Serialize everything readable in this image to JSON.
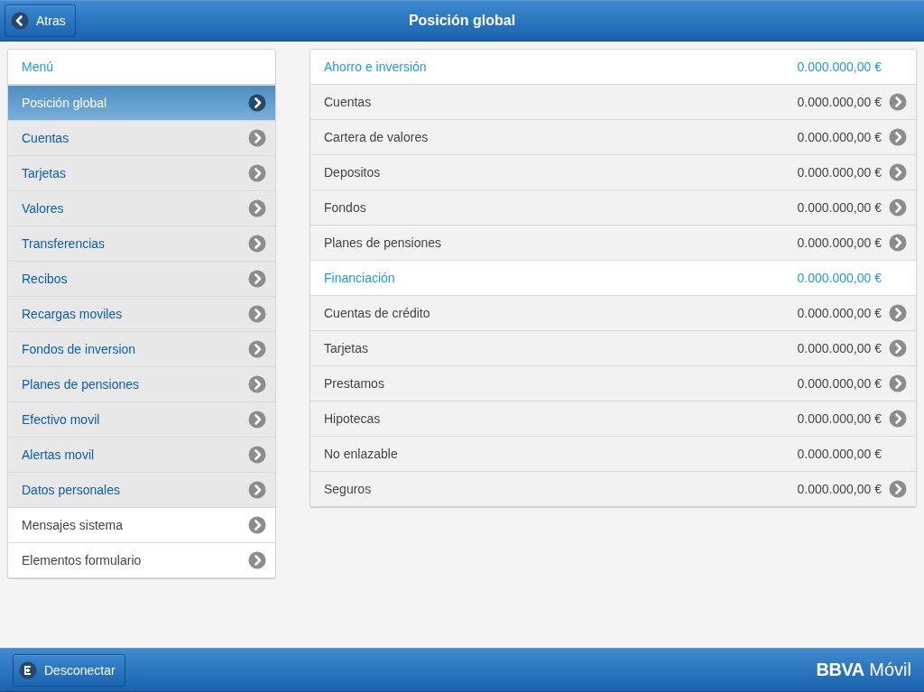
{
  "header": {
    "back_button": "Atras",
    "title": "Posición global"
  },
  "menu": {
    "title": "Menú",
    "items": [
      {
        "label": "Posición global",
        "kind": "primary",
        "selected": true
      },
      {
        "label": "Cuentas",
        "kind": "primary",
        "selected": false
      },
      {
        "label": "Tarjetas",
        "kind": "primary",
        "selected": false
      },
      {
        "label": "Valores",
        "kind": "primary",
        "selected": false
      },
      {
        "label": "Transferencias",
        "kind": "primary",
        "selected": false
      },
      {
        "label": "Recibos",
        "kind": "primary",
        "selected": false
      },
      {
        "label": "Recargas moviles",
        "kind": "primary",
        "selected": false
      },
      {
        "label": "Fondos de inversion",
        "kind": "primary",
        "selected": false
      },
      {
        "label": "Planes de pensiones",
        "kind": "primary",
        "selected": false
      },
      {
        "label": "Efectivo movil",
        "kind": "primary",
        "selected": false
      },
      {
        "label": "Alertas movil",
        "kind": "primary",
        "selected": false
      },
      {
        "label": "Datos personales",
        "kind": "primary",
        "selected": false
      },
      {
        "label": "Mensajes sistema",
        "kind": "secondary",
        "selected": false
      },
      {
        "label": "Elementos formulario",
        "kind": "secondary",
        "selected": false
      }
    ]
  },
  "summary": [
    {
      "kind": "header",
      "label": "Ahorro e inversión",
      "amount": "0.000.000,00 €",
      "linked": false
    },
    {
      "kind": "item",
      "label": "Cuentas",
      "amount": "0.000.000,00 €",
      "linked": true
    },
    {
      "kind": "item",
      "label": "Cartera de valores",
      "amount": "0.000.000,00 €",
      "linked": true
    },
    {
      "kind": "item",
      "label": "Depositos",
      "amount": "0.000.000,00 €",
      "linked": true
    },
    {
      "kind": "item",
      "label": "Fondos",
      "amount": "0.000.000,00 €",
      "linked": true
    },
    {
      "kind": "item",
      "label": "Planes de pensiones",
      "amount": "0.000.000,00 €",
      "linked": true
    },
    {
      "kind": "header",
      "label": "Financiación",
      "amount": "0.000.000,00 €",
      "linked": false
    },
    {
      "kind": "item",
      "label": "Cuentas de crédito",
      "amount": "0.000.000,00 €",
      "linked": true
    },
    {
      "kind": "item",
      "label": "Tarjetas",
      "amount": "0.000.000,00 €",
      "linked": true
    },
    {
      "kind": "item",
      "label": "Prestamos",
      "amount": "0.000.000,00 €",
      "linked": true
    },
    {
      "kind": "item",
      "label": "Hipotecas",
      "amount": "0.000.000,00 €",
      "linked": true
    },
    {
      "kind": "item",
      "label": "No enlazable",
      "amount": "0.000.000,00 €",
      "linked": false
    },
    {
      "kind": "item",
      "label": "Seguros",
      "amount": "0.000.000,00 €",
      "linked": true
    }
  ],
  "footer": {
    "logout_button": "Desconectar",
    "brand": "BBVA",
    "brand_suffix": "Móvil"
  }
}
